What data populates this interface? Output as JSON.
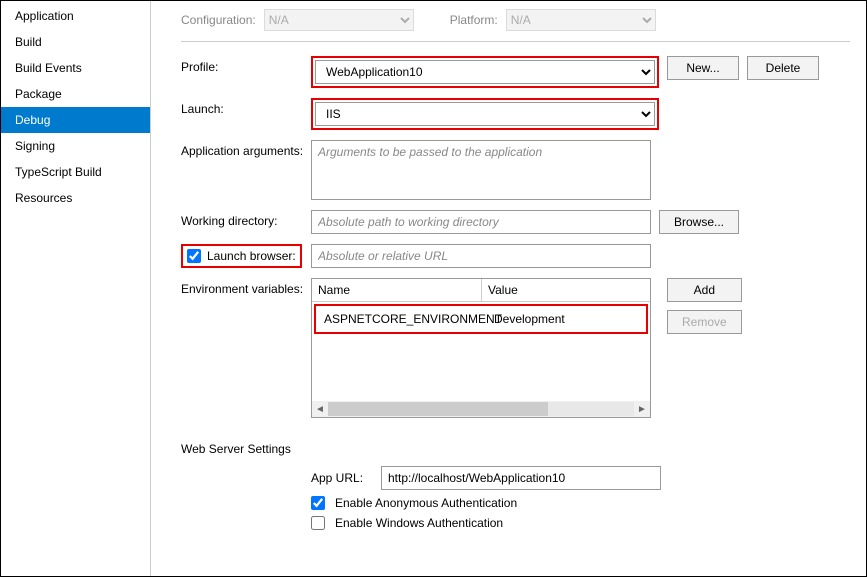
{
  "sidebar": {
    "items": [
      {
        "label": "Application"
      },
      {
        "label": "Build"
      },
      {
        "label": "Build Events"
      },
      {
        "label": "Package"
      },
      {
        "label": "Debug"
      },
      {
        "label": "Signing"
      },
      {
        "label": "TypeScript Build"
      },
      {
        "label": "Resources"
      }
    ]
  },
  "top": {
    "config_label": "Configuration:",
    "config_value": "N/A",
    "platform_label": "Platform:",
    "platform_value": "N/A"
  },
  "labels": {
    "profile": "Profile:",
    "launch": "Launch:",
    "app_args": "Application arguments:",
    "working_dir": "Working directory:",
    "launch_browser": "Launch browser:",
    "env_vars": "Environment variables:",
    "web_server": "Web Server Settings",
    "app_url": "App URL:"
  },
  "fields": {
    "profile": "WebApplication10",
    "launch": "IIS",
    "app_args_ph": "Arguments to be passed to the application",
    "working_dir_ph": "Absolute path to working directory",
    "launch_browser_ph": "Absolute or relative URL",
    "launch_browser_checked": true,
    "app_url": "http://localhost/WebApplication10",
    "anon_auth_label": "Enable Anonymous Authentication",
    "anon_auth_checked": true,
    "win_auth_label": "Enable Windows Authentication",
    "win_auth_checked": false
  },
  "buttons": {
    "new": "New...",
    "delete": "Delete",
    "browse": "Browse...",
    "add": "Add",
    "remove": "Remove"
  },
  "env": {
    "col_name": "Name",
    "col_value": "Value",
    "rows": [
      {
        "name": "ASPNETCORE_ENVIRONMENT",
        "value": "Development"
      }
    ]
  }
}
